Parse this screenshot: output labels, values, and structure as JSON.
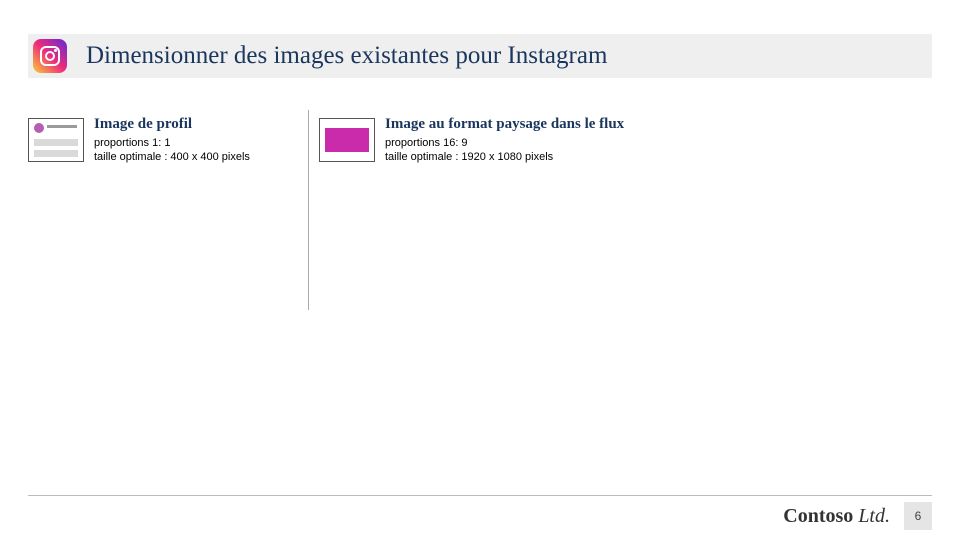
{
  "slide": {
    "title": "Dimensionner des images existantes pour Instagram"
  },
  "specs": {
    "profile": {
      "title": "Image de profil",
      "line1": "proportions 1: 1",
      "line2": "taille optimale : 400 x 400 pixels"
    },
    "landscape": {
      "title": "Image au format paysage dans le flux",
      "line1": "proportions 16: 9",
      "line2": "taille optimale : 1920 x 1080 pixels"
    }
  },
  "footer": {
    "brand_main": "Contoso",
    "brand_suffix": " Ltd.",
    "page_number": "6"
  }
}
